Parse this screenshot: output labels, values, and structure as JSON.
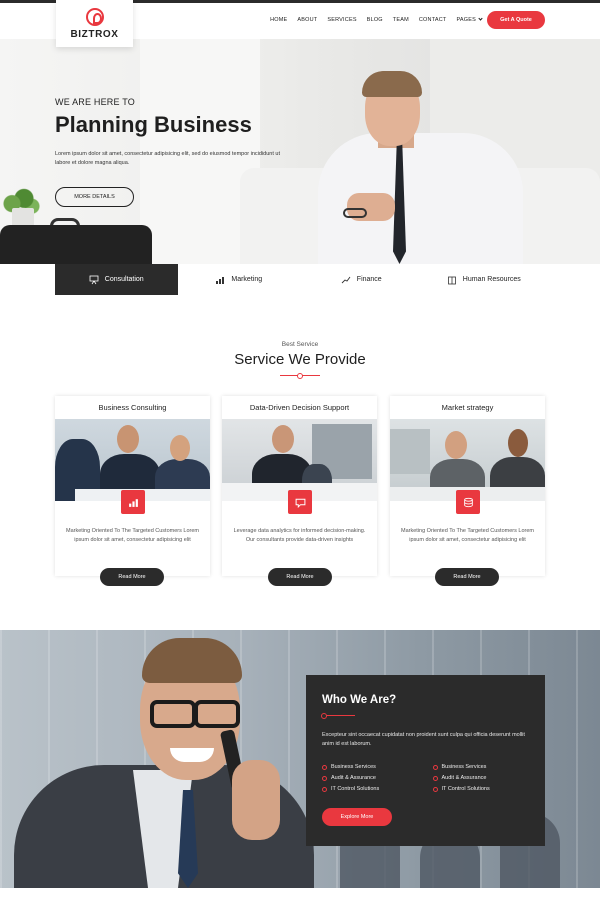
{
  "brand": {
    "name": "BIZTROX",
    "accent": "#e9383f",
    "dark": "#2b2b2b"
  },
  "nav": {
    "items": [
      "HOME",
      "ABOUT",
      "SERVICES",
      "BLOG",
      "TEAM",
      "CONTACT",
      "PAGES"
    ],
    "cta": "Get A Quote"
  },
  "hero": {
    "kicker": "WE ARE HERE TO",
    "title": "Planning Business",
    "description": "Lorem ipsum dolor sit amet, consectetur adipisicing elit, sed do eiusmod tempor incididunt ut labore et dolore magna aliqua.",
    "button": "MORE DETAILS"
  },
  "tabs": [
    {
      "label": "Consultation",
      "icon": "presentation-icon",
      "active": true
    },
    {
      "label": "Marketing",
      "icon": "bar-chart-icon",
      "active": false
    },
    {
      "label": "Finance",
      "icon": "trend-line-icon",
      "active": false
    },
    {
      "label": "Human Resources",
      "icon": "box-icon",
      "active": false
    }
  ],
  "services": {
    "kicker": "Best Service",
    "title": "Service We Provide",
    "cards": [
      {
        "title": "Business Consulting",
        "icon": "bar-chart-icon",
        "text": "Marketing Oriented To The Targeted Customers Lorem ipsum dolor sit amet, consectetur adipisicing elit",
        "button": "Read More"
      },
      {
        "title": "Data-Driven Decision Support",
        "icon": "chat-bubble-icon",
        "text": "Leverage data analytics for informed decision-making. Our consultants provide data-driven insights",
        "button": "Read More"
      },
      {
        "title": "Market strategy",
        "icon": "database-icon",
        "text": "Marketing Oriented To The Targeted Customers Lorem ipsum dolor sit amet, consectetur adipisicing elit",
        "button": "Read More"
      }
    ]
  },
  "who": {
    "title": "Who We Are?",
    "description": "Excepteur sint occaecat cupidatat non proident sunt culpa qui officia deserunt mollit anim id est laborum.",
    "list": [
      "Business Services",
      "Business Services",
      "Audit & Assurance",
      "Audit & Assurance",
      "IT Control Solutions",
      "IT Control Solutions"
    ],
    "button": "Explore More"
  }
}
